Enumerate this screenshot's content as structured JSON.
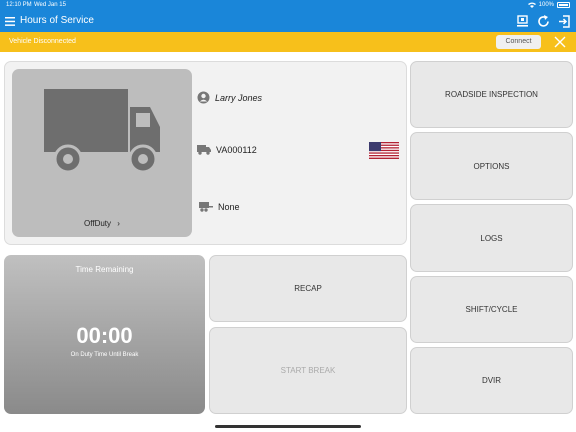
{
  "status_bar": {
    "time": "12:10 PM",
    "date": "Wed Jan 15",
    "battery": "100%"
  },
  "nav": {
    "title": "Hours of Service"
  },
  "banner": {
    "message": "Vehicle Disconnected",
    "connect_label": "Connect"
  },
  "driver": {
    "name": "Larry Jones",
    "vehicle": "VA000112",
    "trailer": "None",
    "duty_status": "OffDuty",
    "status_chevron": "›"
  },
  "timer": {
    "title": "Time Remaining",
    "value": "00:00",
    "subtitle": "On Duty Time Until Break"
  },
  "actions": {
    "roadside": "ROADSIDE INSPECTION",
    "options": "OPTIONS",
    "logs": "LOGS",
    "shift_cycle": "SHIFT/CYCLE",
    "dvir": "DVIR",
    "recap": "RECAP",
    "start_break": "START BREAK"
  },
  "colors": {
    "nav": "#1a86d9",
    "banner": "#f7c01b",
    "panel": "#f2f2f2"
  },
  "icons": [
    "menu-icon",
    "wifi-icon",
    "battery-icon",
    "transfer-icon",
    "refresh-icon",
    "logout-icon",
    "close-icon",
    "truck-icon",
    "person-icon",
    "truck-small-icon",
    "trailer-icon",
    "us-flag-icon"
  ]
}
